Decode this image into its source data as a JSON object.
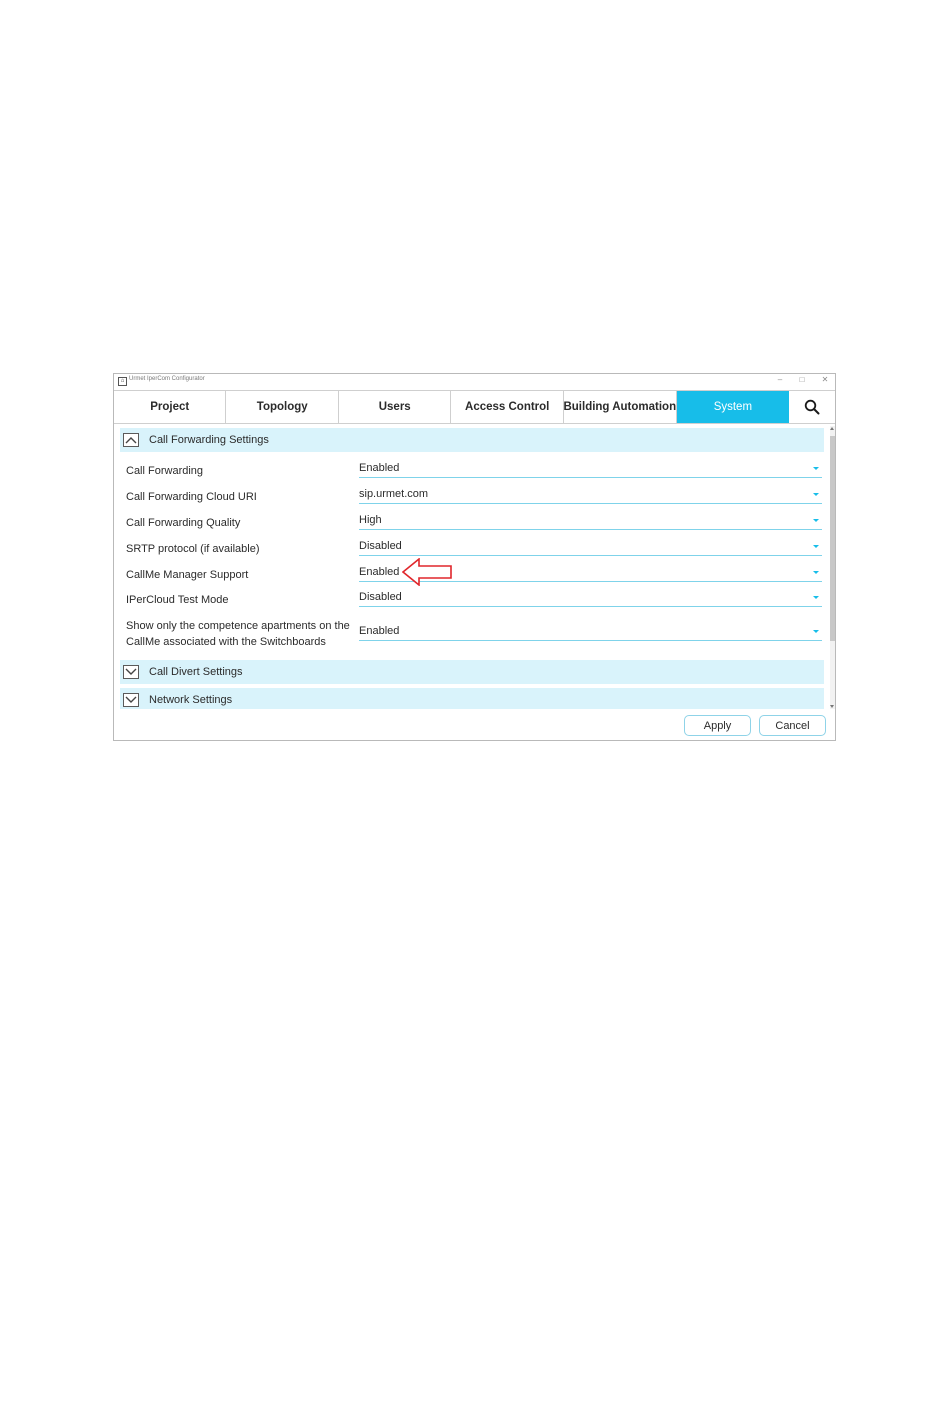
{
  "window": {
    "title": "Urmet IperCom Configurator",
    "controls": {
      "minimize": "–",
      "maximize": "□",
      "close": "✕"
    }
  },
  "tabs": [
    {
      "label": "Project",
      "active": false
    },
    {
      "label": "Topology",
      "active": false
    },
    {
      "label": "Users",
      "active": false
    },
    {
      "label": "Access Control",
      "active": false
    },
    {
      "label": "Building Automation",
      "active": false
    },
    {
      "label": "System",
      "active": true
    }
  ],
  "search_icon": "search-icon",
  "sections": {
    "call_forwarding": {
      "title": "Call Forwarding Settings",
      "expanded": true,
      "fields": [
        {
          "label": "Call Forwarding",
          "value": "Enabled"
        },
        {
          "label": "Call Forwarding Cloud URI",
          "value": "sip.urmet.com"
        },
        {
          "label": "Call Forwarding Quality",
          "value": "High"
        },
        {
          "label": "SRTP protocol (if available)",
          "value": "Disabled"
        },
        {
          "label": "CallMe Manager Support",
          "value": "Enabled"
        },
        {
          "label": "IPerCloud Test Mode",
          "value": "Disabled"
        },
        {
          "label_line1": "Show only the competence apartments on the",
          "label_line2": "CallMe associated with the Switchboards",
          "value": "Enabled"
        }
      ]
    },
    "call_divert": {
      "title": "Call Divert Settings",
      "expanded": false
    },
    "network": {
      "title": "Network Settings",
      "expanded": false
    }
  },
  "buttons": {
    "apply": "Apply",
    "cancel": "Cancel"
  },
  "colors": {
    "accent": "#17bde9",
    "section_bg": "#d9f3fb",
    "annotation_arrow": "#e0262b"
  }
}
